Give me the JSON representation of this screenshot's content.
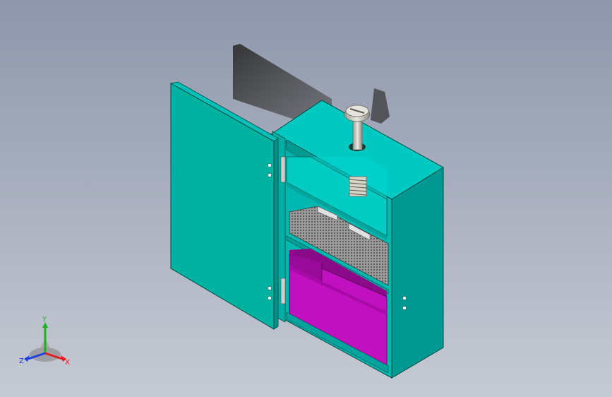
{
  "viewport": {
    "background_top": "#8e97ab",
    "background_bottom": "#c6cad4"
  },
  "model": {
    "body_color": "#00b4a4",
    "top_color": "#00c8c0",
    "side_color": "#009488",
    "drawer_color": "#c000c0",
    "screw_color": "#c8c8c0",
    "icon": "wall-cabinet-assembly-icon"
  },
  "triad": {
    "x_label": "X",
    "y_label": "Y",
    "z_label": "Z",
    "x_color": "#e02020",
    "y_color": "#20b020",
    "z_color": "#2040e0",
    "icon": "coordinate-triad-icon"
  }
}
